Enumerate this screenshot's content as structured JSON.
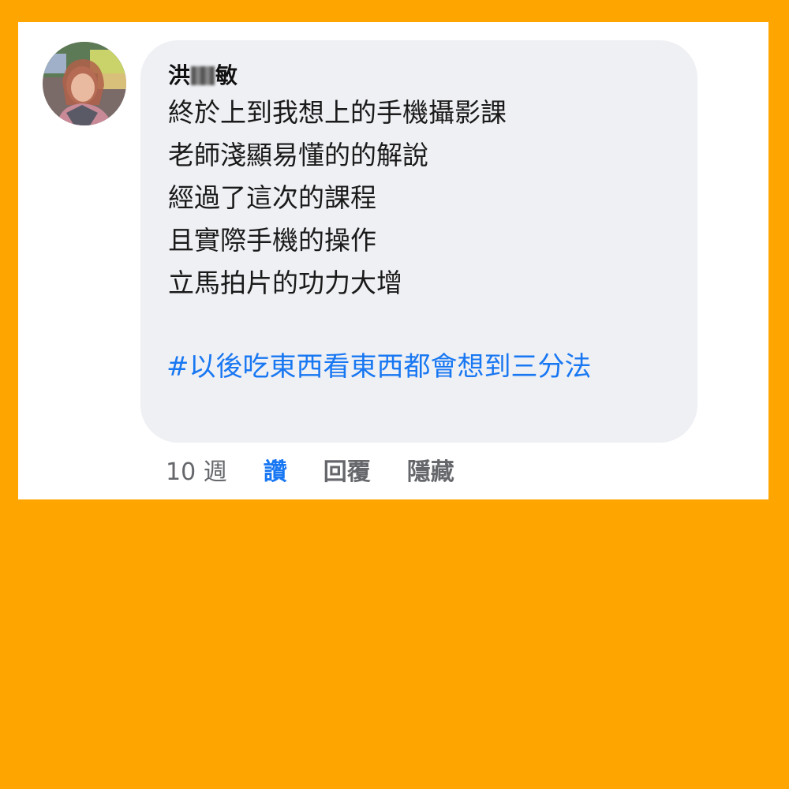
{
  "comment": {
    "author_prefix": "洪",
    "author_suffix": "敏",
    "lines": [
      "終於上到我想上的手機攝影課",
      "老師淺顯易懂的的解說",
      "經過了這次的課程",
      "且實際手機的操作",
      "立馬拍片的功力大增"
    ],
    "hashtag": "#以後吃東西看東西都會想到三分法"
  },
  "actions": {
    "time": "10 週",
    "like": "讚",
    "reply": "回覆",
    "hide": "隱藏"
  },
  "colors": {
    "background": "#FFA500",
    "bubble": "#EFF0F4",
    "link": "#1877F2",
    "muted": "#65676B"
  }
}
